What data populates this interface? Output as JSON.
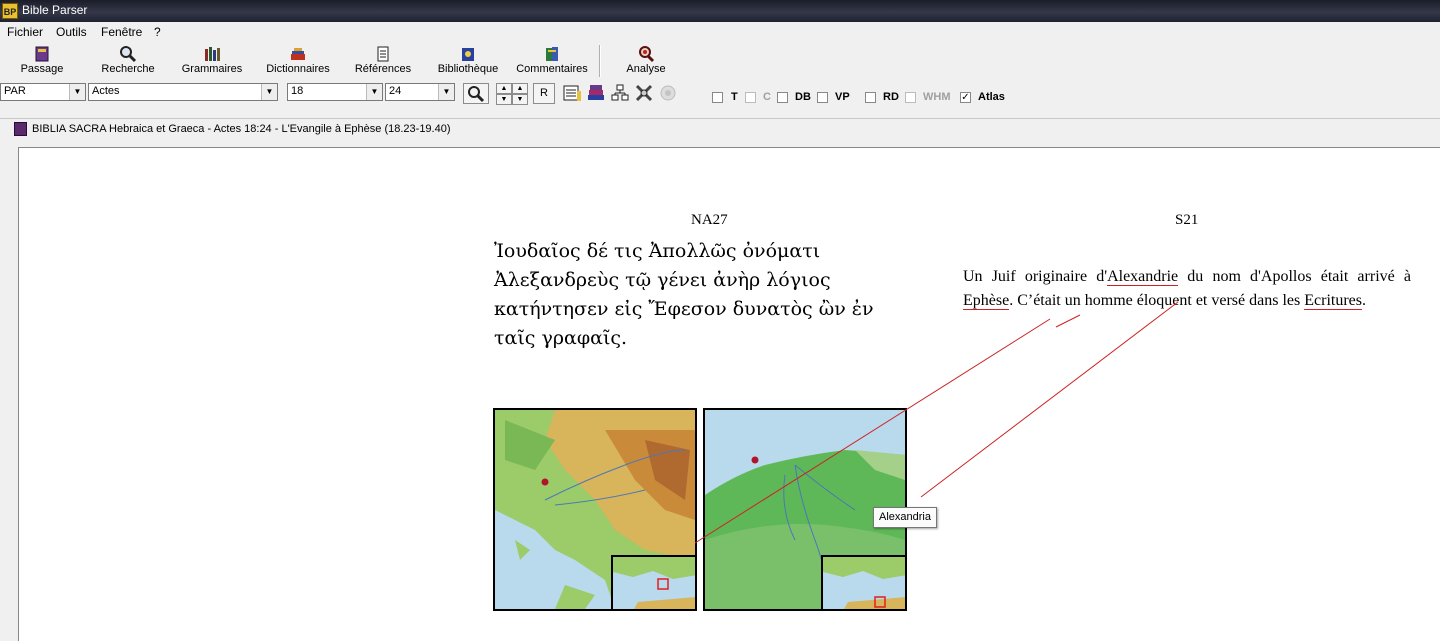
{
  "window": {
    "title": "Bible Parser",
    "app_icon": "BP"
  },
  "menu": [
    {
      "label": "Fichier"
    },
    {
      "label": "Outils"
    },
    {
      "label": "Fenêtre"
    },
    {
      "label": "?"
    }
  ],
  "toolbar": [
    {
      "label": "Passage",
      "icon": "passage-book-icon"
    },
    {
      "label": "Recherche",
      "icon": "search-magnifier-icon"
    },
    {
      "label": "Grammaires",
      "icon": "grammar-books-icon"
    },
    {
      "label": "Dictionnaires",
      "icon": "dictionary-icon"
    },
    {
      "label": "Références",
      "icon": "references-icon"
    },
    {
      "label": "Bibliothèque",
      "icon": "library-icon"
    },
    {
      "label": "Commentaires",
      "icon": "commentary-icon"
    },
    {
      "label": "Analyse",
      "icon": "analysis-icon"
    }
  ],
  "selectors": {
    "version": "PAR",
    "book": "Actes",
    "chapter": "18",
    "verse": "24",
    "r_button": "R"
  },
  "checkboxes": [
    {
      "label": "T",
      "checked": false,
      "enabled": true
    },
    {
      "label": "C",
      "checked": false,
      "enabled": false
    },
    {
      "label": "DB",
      "checked": false,
      "enabled": true
    },
    {
      "label": "VP",
      "checked": false,
      "enabled": true
    },
    {
      "label": "RD",
      "checked": false,
      "enabled": true
    },
    {
      "label": "WHM",
      "checked": false,
      "enabled": false
    },
    {
      "label": "Atlas",
      "checked": true,
      "enabled": true
    }
  ],
  "document": {
    "title": "BIBLIA SACRA Hebraica et Graeca - Actes 18:24 - L'Evangile à Ephèse (18.23-19.40)",
    "left_column": {
      "heading": "NA27",
      "text": "Ἰουδαῖος δέ τις Ἀπολλῶς ὀνόματι Ἀλεξανδρεὺς τῷ γένει ἀνὴρ λόγιος κατήντησεν εἰς Ἔφεσον δυνατὸς ὢν ἐν ταῖς γραφαῖς."
    },
    "right_column": {
      "heading": "S21",
      "text_1": "Un Juif originaire d'",
      "link_1": "Alexandrie",
      "text_2": " du nom d'Apollos était arrivé à ",
      "link_2": "Ephèse",
      "text_3": ". C’était un homme éloquent et versé dans les ",
      "link_3": "Ecritures",
      "text_4": "."
    },
    "maps": [
      {
        "name": "ephesus-map"
      },
      {
        "name": "alexandria-map"
      }
    ],
    "tooltip": "Alexandria",
    "colors": {
      "link_underline": "#cc2222",
      "leader_line": "#cc2222"
    }
  }
}
